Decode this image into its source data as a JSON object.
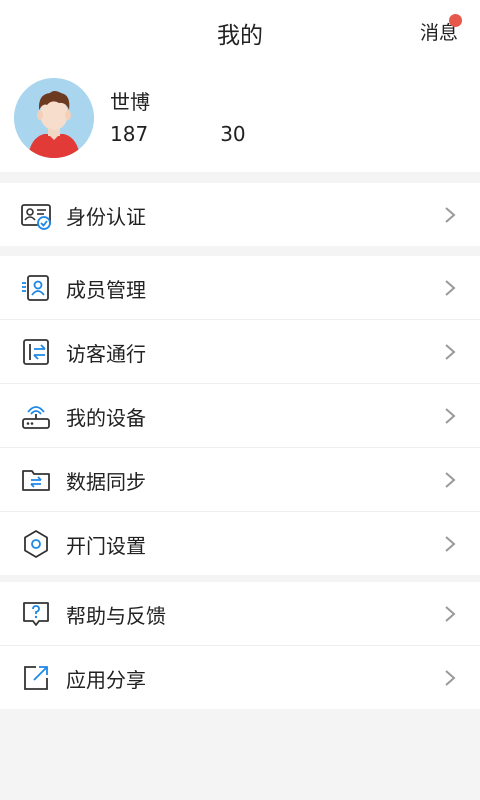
{
  "header": {
    "title": "我的",
    "message_label": "消息"
  },
  "profile": {
    "name": "世博",
    "phone_prefix": "187",
    "phone_suffix": "30"
  },
  "menu": {
    "identity": "身份认证",
    "members": "成员管理",
    "visitors": "访客通行",
    "devices": "我的设备",
    "sync": "数据同步",
    "door": "开门设置",
    "help": "帮助与反馈",
    "share": "应用分享"
  },
  "colors": {
    "accent": "#1e88e5",
    "badge": "#e8574b",
    "background": "#f4f4f4"
  }
}
